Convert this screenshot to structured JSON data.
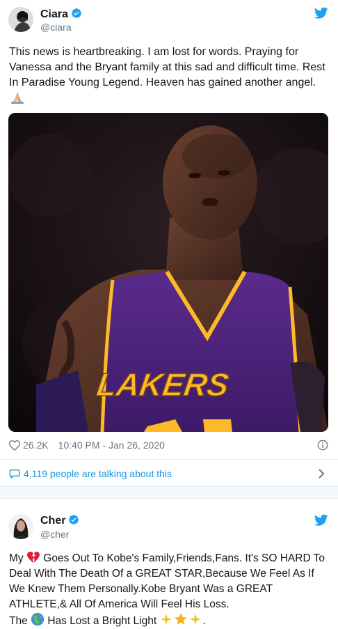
{
  "tweets": [
    {
      "name": "Ciara",
      "handle": "@ciara",
      "text": "This news is heartbreaking. I am lost for words. Praying for Vanessa and the Bryant family at this sad and difficult time. Rest In Paradise Young Legend. Heaven has gained another angel.",
      "emoji_end": "folded-hands-icon",
      "jersey_text": "LAKERS",
      "likes": "26.2K",
      "timestamp": "10:40 PM - Jan 26, 2020",
      "talking": "4,119 people are talking about this"
    },
    {
      "name": "Cher",
      "handle": "@cher",
      "line1_a": "My",
      "line1_b": "Goes Out To Kobe's Family,Friends,Fans. It's SO HARD To",
      "line2": "Deal With The Death Of a GREAT STAR,Because We Feel As If",
      "line3": "We Knew Them Personally.Kobe Bryant Was a GREAT",
      "line4": "ATHLETE,& All Of America Will Feel His Loss.",
      "line5_a": "The",
      "line5_b": "Has Lost a Bright Light",
      "line5_c": "."
    }
  ],
  "colors": {
    "twitter_blue": "#1da1f2",
    "link": "#1b95e0",
    "secondary": "#657786",
    "lakers_purple": "#552583",
    "lakers_gold": "#fdb927"
  }
}
